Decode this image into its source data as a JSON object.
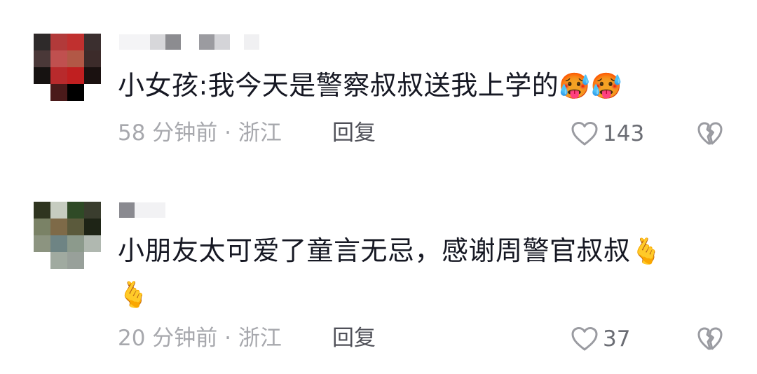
{
  "comments": [
    {
      "username": "",
      "text": "小女孩:我今天是警察叔叔送我上学的",
      "emojis": [
        "🥵",
        "🥵"
      ],
      "emoji_icon": "face-eating-watermelon-icon",
      "time_location": "58 分钟前 · 浙江",
      "reply_label": "回复",
      "like_count": "143",
      "avatar_colors": [
        "#2e2a2a",
        "#b23a3a",
        "#c0302f",
        "#3b2f2f",
        "#4a3838",
        "#c0504f",
        "#b25846",
        "#3c2b2a",
        "#161211",
        "#b82a2c",
        "#c01f20",
        "#1a1110",
        "#ffffff",
        "#4a1a1a",
        "#000000",
        "#ffffff"
      ]
    },
    {
      "username": "",
      "text": "小朋友太可爱了童言无忌，感谢周警官叔叔",
      "emojis": [
        "🫰",
        "🫰"
      ],
      "emoji_icon": "finger-heart-icon",
      "time_location": "20 分钟前 · 浙江",
      "reply_label": "回复",
      "like_count": "37",
      "avatar_colors": [
        "#2f3520",
        "#c6ccc0",
        "#2f4a26",
        "#3a3d2e",
        "#7a8266",
        "#7e6a48",
        "#5b5a3c",
        "#1e2416",
        "#8c9480",
        "#6e8484",
        "#8c9a8c",
        "#b0b8b0",
        "#ffffff",
        "#a0aaa0",
        "#98a09a",
        "#ffffff"
      ]
    }
  ],
  "icons": {
    "like": "heart-outline-icon",
    "dislike": "broken-heart-icon"
  },
  "colors": {
    "text": "#161823",
    "meta": "#a7a8ad",
    "reply": "#4f5058",
    "icon": "#9a9ba1"
  }
}
